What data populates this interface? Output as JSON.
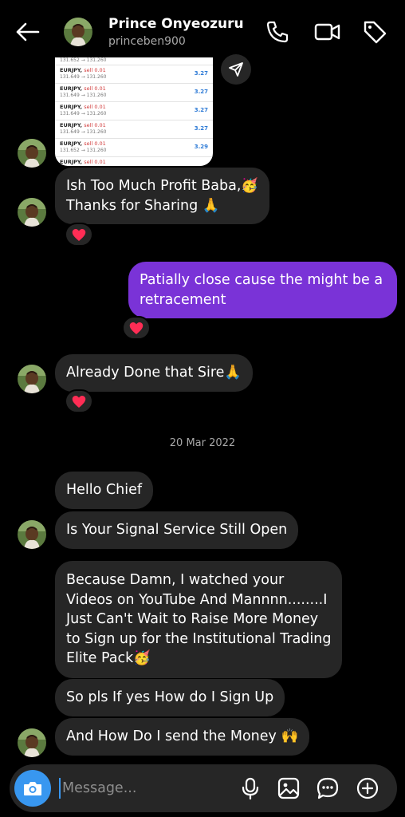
{
  "header": {
    "name": "Prince Onyeozuru",
    "username": "princeben900"
  },
  "screenshot": {
    "trades": [
      {
        "pair": "",
        "type": "",
        "prices": "131.652 → 131.260",
        "pnl": ""
      },
      {
        "pair": "EURJPY,",
        "type": "sell 0.01",
        "prices": "131.649 → 131.260",
        "pnl": "3.27"
      },
      {
        "pair": "EURJPY,",
        "type": "sell 0.01",
        "prices": "131.649 → 131.260",
        "pnl": "3.27"
      },
      {
        "pair": "EURJPY,",
        "type": "sell 0.01",
        "prices": "131.649 → 131.260",
        "pnl": "3.27"
      },
      {
        "pair": "EURJPY,",
        "type": "sell 0.01",
        "prices": "131.649 → 131.260",
        "pnl": "3.27"
      },
      {
        "pair": "EURJPY,",
        "type": "sell 0.01",
        "prices": "131.652 → 131.260",
        "pnl": "3.29"
      },
      {
        "pair": "EURJPY,",
        "type": "sell 0.01",
        "prices": "",
        "pnl": ""
      }
    ]
  },
  "messages": {
    "m1_line1": "Ish Too Much Profit Baba,🥳",
    "m1_line2": "Thanks for Sharing 🙏",
    "m2_line1": "Patially close cause the might be a",
    "m2_line2": "retracement",
    "m3": "Already Done that Sire🙏",
    "date": "20 Mar 2022",
    "m4": "Hello Chief",
    "m5": "Is Your Signal Service Still Open",
    "m6_line1": "Because Damn, I watched your",
    "m6_line2": "Videos on YouTube And Mannnn........I",
    "m6_line3": "Just Can't Wait to Raise More Money",
    "m6_line4": "to Sign up for the Institutional Trading",
    "m6_line5": "Elite Pack🥳",
    "m7": "So pls If yes How do I Sign Up",
    "m8": "And How Do I send the Money 🙌"
  },
  "composer": {
    "placeholder": "Message..."
  },
  "colors": {
    "outgoing_bubble": "#7a33d7",
    "incoming_bubble": "#262626",
    "camera_button": "#3897f0",
    "reaction_heart": "#ff2d55"
  },
  "icons": {
    "back": "arrow-left-icon",
    "phone": "phone-icon",
    "video": "video-icon",
    "tag": "tag-icon",
    "share": "send-icon",
    "heart": "heart-icon",
    "camera": "camera-icon",
    "mic": "microphone-icon",
    "gallery": "image-icon",
    "sticker": "sticker-chat-icon",
    "plus": "plus-circle-icon"
  }
}
